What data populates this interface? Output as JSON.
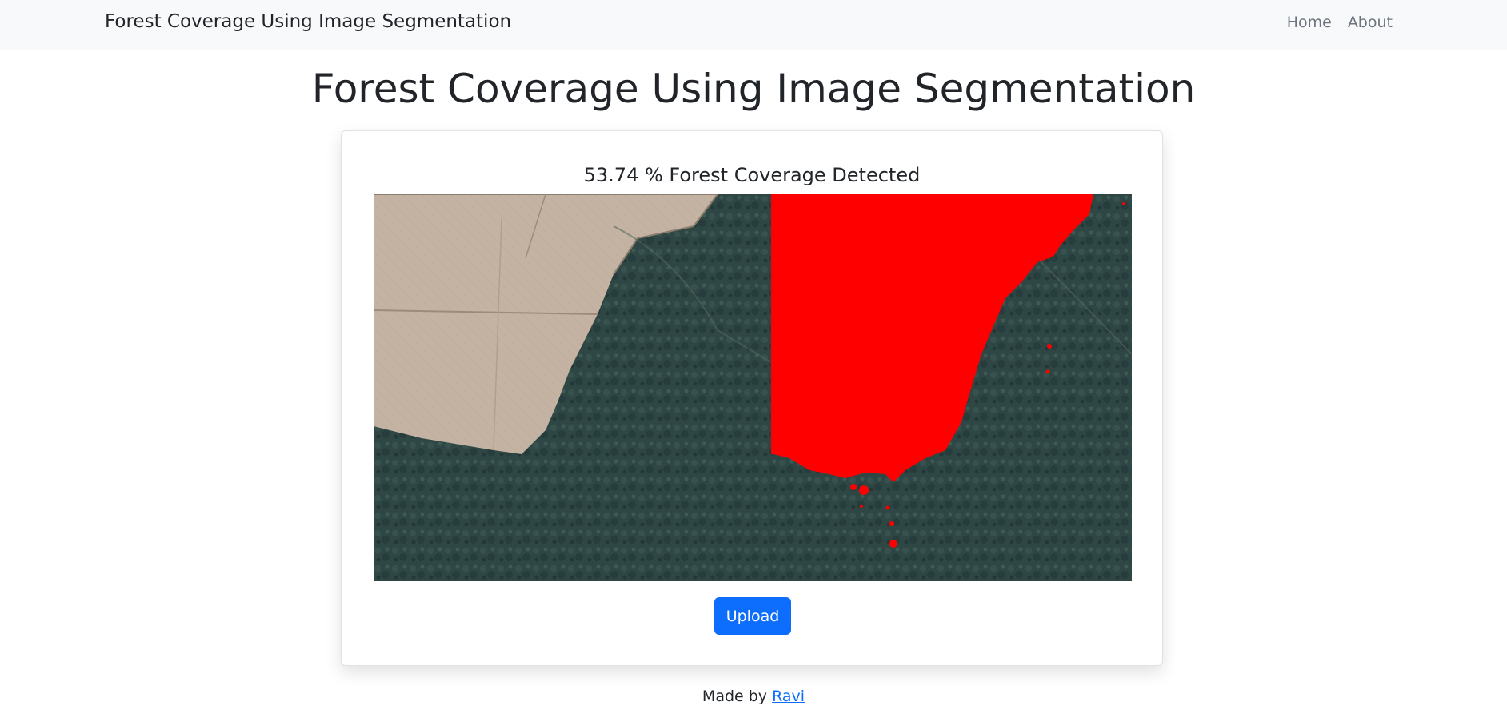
{
  "navbar": {
    "brand": "Forest Coverage Using Image Segmentation",
    "links": [
      {
        "label": "Home"
      },
      {
        "label": "About"
      }
    ]
  },
  "main": {
    "title": "Forest Coverage Using Image Segmentation",
    "result": {
      "coverage_text": "53.74 % Forest Coverage Detected",
      "coverage_percent": 53.74
    },
    "upload_label": "Upload"
  },
  "footer": {
    "prefix": "Made by",
    "author": "Ravi"
  },
  "colors": {
    "navbar_bg": "#f8f9fa",
    "primary": "#0d6efd",
    "segmentation_mask": "#ff0000",
    "forest": "#2f4744",
    "field": "#c2b1a0"
  }
}
